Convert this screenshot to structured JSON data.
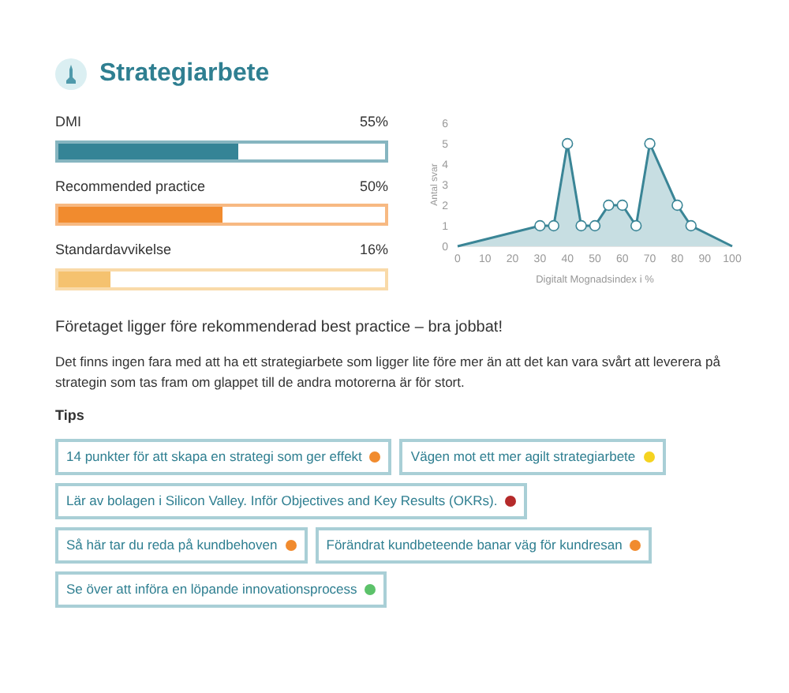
{
  "title": "Strategiarbete",
  "bars": [
    {
      "label": "DMI",
      "reading": "55%",
      "level": 0.55,
      "color": "#358496"
    },
    {
      "label": "Recommended practice",
      "reading": "50%",
      "level": 0.5,
      "color": "#f18b2e"
    },
    {
      "label": "Standardavvikelse",
      "reading": "16%",
      "level": 0.16,
      "color": "#f5c26f"
    }
  ],
  "chart": {
    "chart_data": {
      "type": "area",
      "xlabel": "Digitalt Mognadsindex i %",
      "ylabel": "Antal svar",
      "x": [
        0,
        30,
        35,
        40,
        45,
        50,
        55,
        60,
        65,
        70,
        80,
        85,
        100
      ],
      "series": [
        {
          "color": "#3a8596",
          "values": [
            0,
            1,
            1,
            5,
            1,
            1,
            2,
            2,
            1,
            5,
            2,
            1,
            0
          ]
        }
      ],
      "xlim": [
        0,
        100
      ],
      "ylim": [
        0,
        6
      ],
      "xticks": [
        0,
        10,
        20,
        30,
        40,
        50,
        60,
        70,
        80,
        90,
        100
      ],
      "yticks": [
        0,
        1,
        2,
        3,
        4,
        5,
        6
      ]
    }
  },
  "headline": "Företaget ligger före rekommenderad best practice – bra jobbat!",
  "paragraph": "Det finns ingen fara med att ha ett strategiarbete som ligger lite före mer än att det kan vara svårt att leverera på strategin som tas fram om glappet till de andra motorerna är för stort.",
  "tips_heading": "Tips",
  "tips": [
    [
      {
        "label": "14 punkter för att skapa en strategi som ger effekt",
        "color": "#f18b2e"
      },
      {
        "label": "Vägen mot ett mer agilt strategiarbete",
        "color": "#f5d320"
      }
    ],
    [
      {
        "label": "Lär av bolagen i Silicon Valley. Inför Objectives and Key Results (OKRs).",
        "color": "#b52a2a"
      }
    ],
    [
      {
        "label": "Så här tar du reda på kundbehoven",
        "color": "#f18b2e"
      },
      {
        "label": "Förändrat kundbeteende banar väg för kundresan",
        "color": "#f18b2e"
      }
    ],
    [
      {
        "label": "Se över att införa en löpande innovationsprocess",
        "color": "#5cc26a"
      }
    ]
  ]
}
